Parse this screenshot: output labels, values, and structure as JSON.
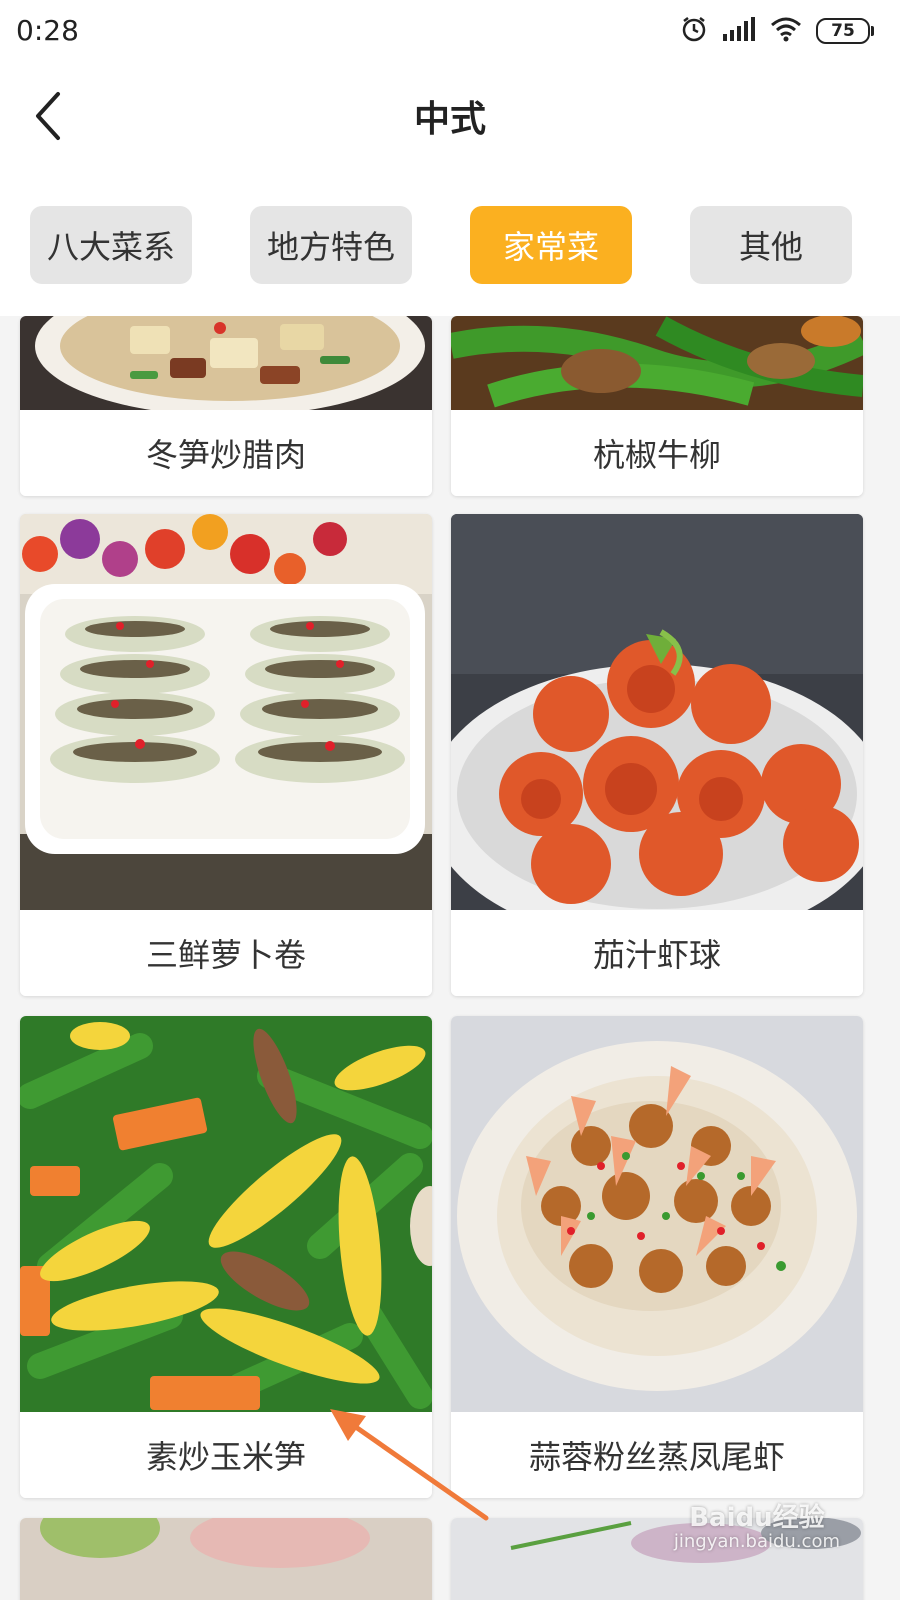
{
  "status_bar": {
    "time": "0:28",
    "battery": "75",
    "icons": [
      "alarm-icon",
      "signal-icon",
      "wifi-icon",
      "battery-icon"
    ]
  },
  "header": {
    "title": "中式",
    "back_icon": "chevron-left-icon"
  },
  "tabs": [
    {
      "label": "八大菜系",
      "active": false
    },
    {
      "label": "地方特色",
      "active": false
    },
    {
      "label": "家常菜",
      "active": true
    },
    {
      "label": "其他",
      "active": false
    }
  ],
  "dishes": [
    {
      "name": "冬笋炒腊肉"
    },
    {
      "name": "杭椒牛柳"
    },
    {
      "name": "三鲜萝卜卷"
    },
    {
      "name": "茄汁虾球"
    },
    {
      "name": "素炒玉米笋"
    },
    {
      "name": "蒜蓉粉丝蒸凤尾虾"
    }
  ],
  "colors": {
    "accent": "#fbb020",
    "tab_inactive": "#e5e5e5",
    "annotation_arrow": "#f07a3a"
  },
  "watermark": {
    "brand": "Baidu经验",
    "url": "jingyan.baidu.com"
  }
}
